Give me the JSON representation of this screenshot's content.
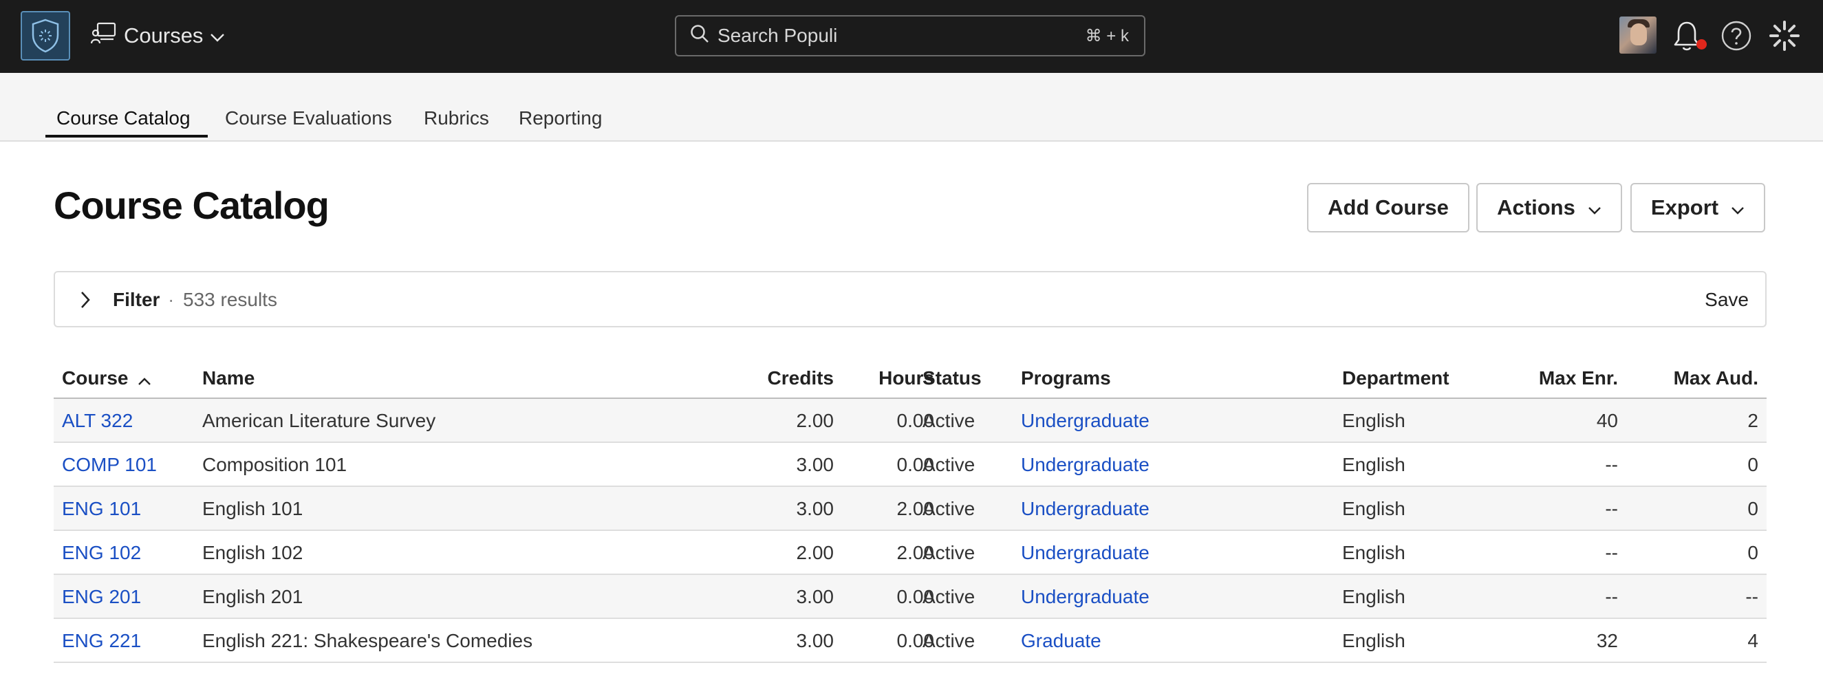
{
  "topbar": {
    "app_name": "Courses",
    "search_placeholder": "Search Populi",
    "search_shortcut": "⌘ + k"
  },
  "tabs": [
    {
      "label": "Course Catalog",
      "active": true
    },
    {
      "label": "Course Evaluations",
      "active": false
    },
    {
      "label": "Rubrics",
      "active": false
    },
    {
      "label": "Reporting",
      "active": false
    }
  ],
  "page": {
    "title": "Course Catalog",
    "add_label": "Add Course",
    "actions_label": "Actions",
    "export_label": "Export"
  },
  "filter": {
    "label": "Filter",
    "separator": "·",
    "count": "533 results",
    "save_label": "Save"
  },
  "table": {
    "headers": {
      "course": "Course",
      "name": "Name",
      "credits": "Credits",
      "hours": "Hours",
      "status": "Status",
      "programs": "Programs",
      "department": "Department",
      "max_enr": "Max Enr.",
      "max_aud": "Max Aud."
    },
    "sort_column": "course",
    "sort_direction": "ascending",
    "rows": [
      {
        "course": "ALT 322",
        "name": "American Literature Survey",
        "credits": "2.00",
        "hours": "0.00",
        "status": "Active",
        "programs": "Undergraduate",
        "department": "English",
        "max_enr": "40",
        "max_aud": "2"
      },
      {
        "course": "COMP 101",
        "name": "Composition 101",
        "credits": "3.00",
        "hours": "0.00",
        "status": "Active",
        "programs": "Undergraduate",
        "department": "English",
        "max_enr": "--",
        "max_aud": "0"
      },
      {
        "course": "ENG 101",
        "name": "English 101",
        "credits": "3.00",
        "hours": "2.00",
        "status": "Active",
        "programs": "Undergraduate",
        "department": "English",
        "max_enr": "--",
        "max_aud": "0"
      },
      {
        "course": "ENG 102",
        "name": "English 102",
        "credits": "2.00",
        "hours": "2.00",
        "status": "Active",
        "programs": "Undergraduate",
        "department": "English",
        "max_enr": "--",
        "max_aud": "0"
      },
      {
        "course": "ENG 201",
        "name": "English 201",
        "credits": "3.00",
        "hours": "0.00",
        "status": "Active",
        "programs": "Undergraduate",
        "department": "English",
        "max_enr": "--",
        "max_aud": "--"
      },
      {
        "course": "ENG 221",
        "name": "English 221: Shakespeare's Comedies",
        "credits": "3.00",
        "hours": "0.00",
        "status": "Active",
        "programs": "Graduate",
        "department": "English",
        "max_enr": "32",
        "max_aud": "4"
      }
    ]
  },
  "colors": {
    "topbar_bg": "#1b1b1b",
    "link": "#1a4fc4",
    "notification": "#e0271c",
    "logo_accent": "#5a8fb8"
  },
  "icons": [
    "populi-logo-icon",
    "courses-app-icon",
    "chevron-down-icon",
    "search-icon",
    "avatar",
    "bell-icon",
    "help-icon",
    "loading-spinner-icon",
    "chevron-right-icon",
    "sort-ascending-icon"
  ]
}
